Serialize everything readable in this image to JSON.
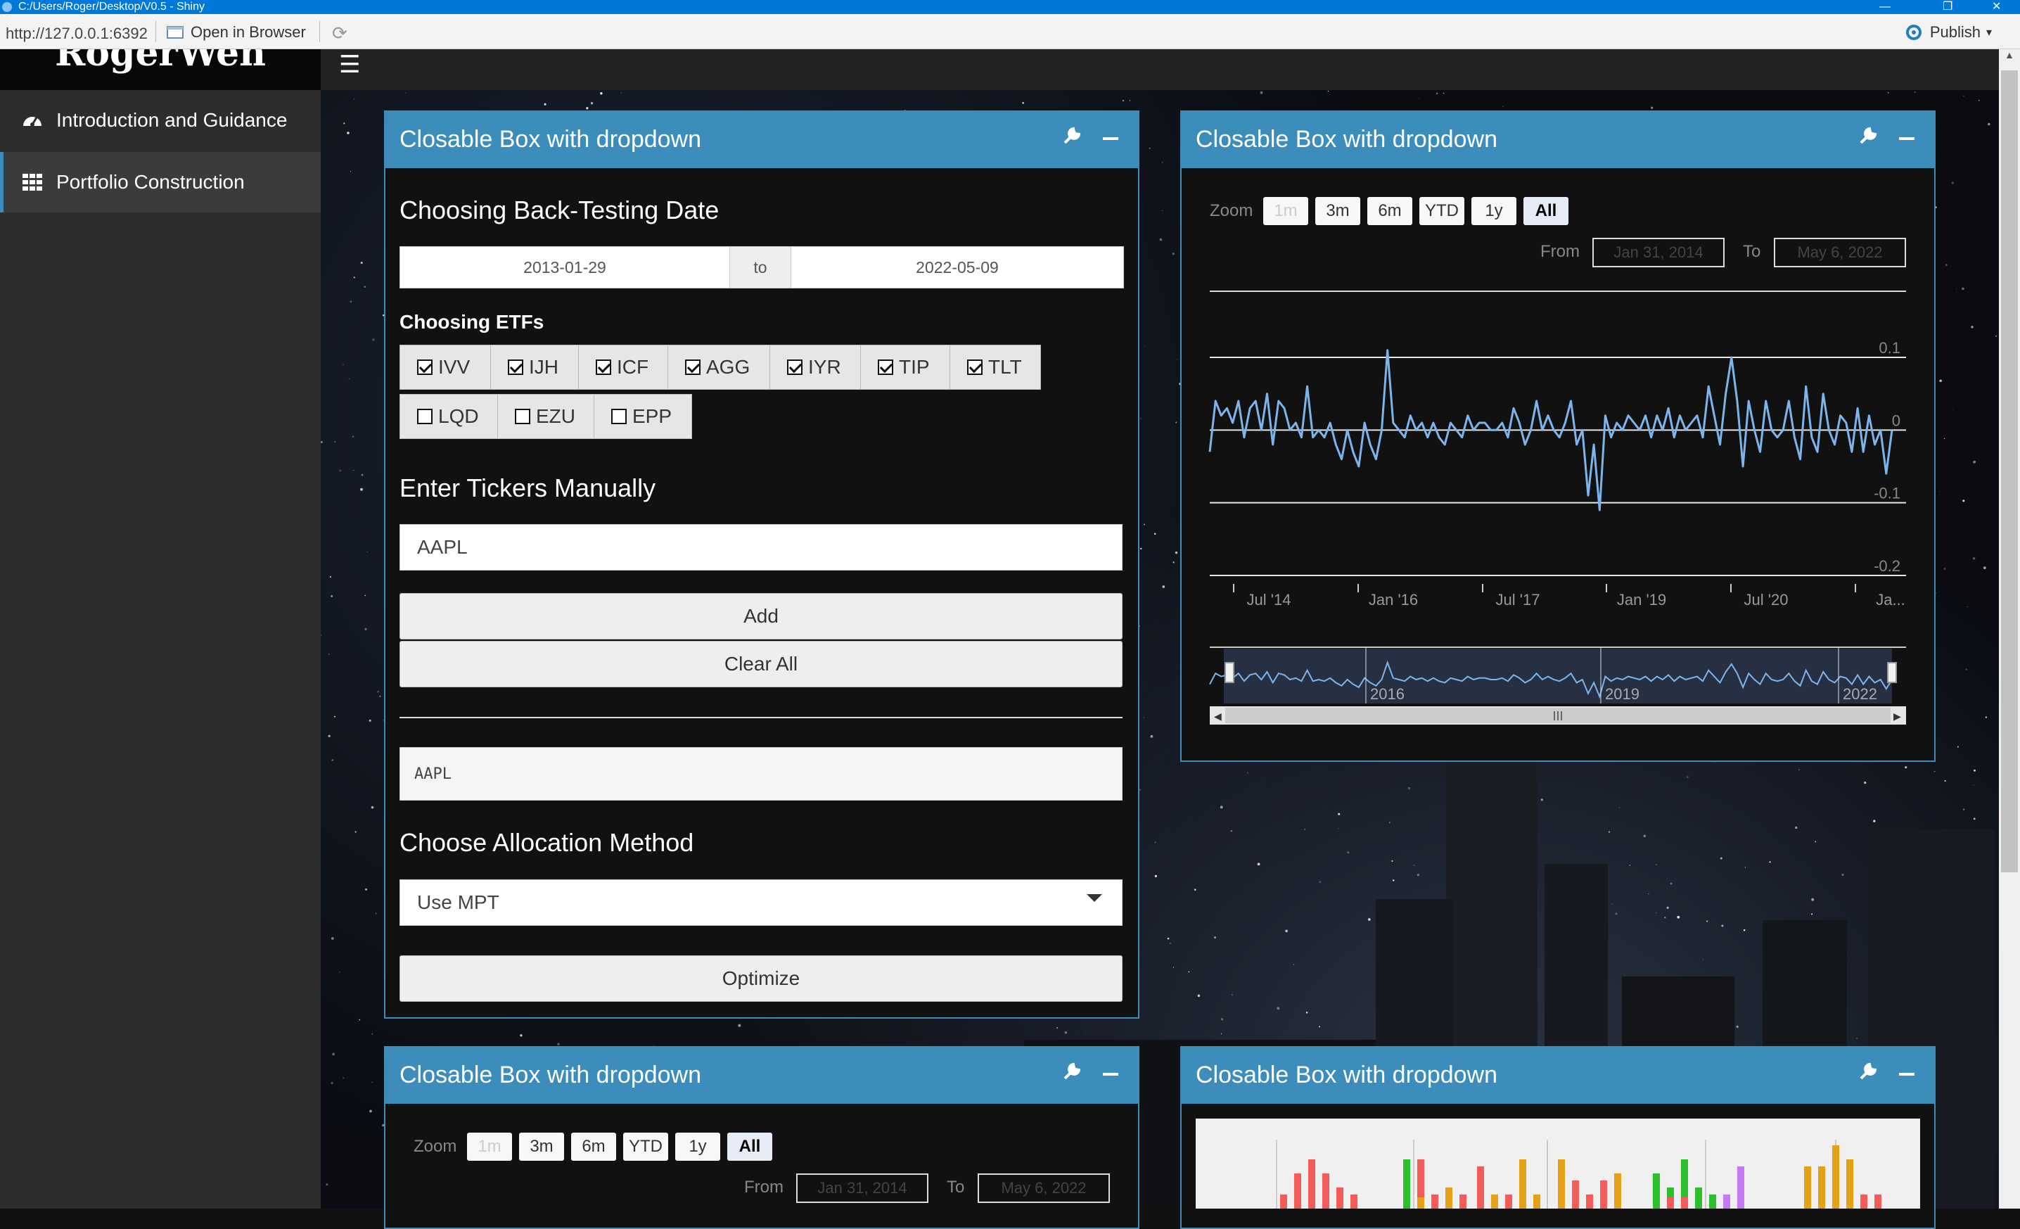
{
  "window": {
    "title": "C:/Users/Roger/Desktop/V0.5 - Shiny",
    "url": "http://127.0.0.1:6392",
    "open_in_browser": "Open in Browser",
    "publish": "Publish"
  },
  "header": {
    "logo": "RogerWen"
  },
  "sidebar": {
    "items": [
      {
        "label": "Introduction and Guidance"
      },
      {
        "label": "Portfolio Construction"
      }
    ]
  },
  "box_title": "Closable Box with dropdown",
  "form": {
    "date_heading": "Choosing Back-Testing Date",
    "date_start": "2013-01-29",
    "date_sep": "to",
    "date_end": "2022-05-09",
    "etf_heading": "Choosing ETFs",
    "etfs": [
      {
        "label": "IVV",
        "checked": true
      },
      {
        "label": "IJH",
        "checked": true
      },
      {
        "label": "ICF",
        "checked": true
      },
      {
        "label": "AGG",
        "checked": true
      },
      {
        "label": "IYR",
        "checked": true
      },
      {
        "label": "TIP",
        "checked": true
      },
      {
        "label": "TLT",
        "checked": true
      },
      {
        "label": "LQD",
        "checked": false
      },
      {
        "label": "EZU",
        "checked": false
      },
      {
        "label": "EPP",
        "checked": false
      }
    ],
    "ticker_heading": "Enter Tickers Manually",
    "ticker_value": "AAPL",
    "add_label": "Add",
    "clear_label": "Clear All",
    "ticker_output": "AAPL",
    "alloc_heading": "Choose Allocation Method",
    "alloc_value": "Use MPT",
    "optimize_label": "Optimize"
  },
  "range_selector": {
    "zoom_label": "Zoom",
    "buttons": [
      "1m",
      "3m",
      "6m",
      "YTD",
      "1y",
      "All"
    ],
    "selected": "All",
    "from_label": "From",
    "from_value": "Jan 31, 2014",
    "to_label": "To",
    "to_value": "May 6, 2022"
  },
  "chart_data": {
    "type": "line",
    "title": "",
    "xlabel": "",
    "ylabel": "",
    "ylim": [
      -0.2,
      0.1
    ],
    "y_ticks": [
      "0.1",
      "0",
      "-0.1",
      "-0.2"
    ],
    "x_ticks": [
      "Jul '14",
      "Jan '16",
      "Jul '17",
      "Jan '19",
      "Jul '20",
      "Ja..."
    ],
    "navigator_ticks": [
      "2016",
      "2019",
      "2022"
    ],
    "series": [
      {
        "color": "#7cb5ec",
        "values": [
          -0.03,
          0.04,
          0.02,
          0.03,
          0.01,
          0.04,
          -0.01,
          0.03,
          0.04,
          0.0,
          0.05,
          -0.02,
          0.04,
          0.03,
          0.0,
          0.01,
          -0.01,
          0.06,
          -0.01,
          0.0,
          -0.01,
          0.01,
          -0.02,
          -0.04,
          0.0,
          -0.03,
          -0.05,
          0.01,
          -0.02,
          -0.04,
          0.0,
          0.11,
          0.01,
          0.0,
          -0.01,
          0.02,
          0.0,
          0.01,
          -0.01,
          0.01,
          -0.01,
          -0.02,
          0.01,
          0.0,
          -0.01,
          0.02,
          0.0,
          0.01,
          0.01,
          0.0,
          0.0,
          0.01,
          -0.01,
          0.03,
          0.01,
          -0.02,
          0.0,
          0.04,
          0.0,
          0.02,
          0.0,
          -0.01,
          0.01,
          0.04,
          -0.02,
          0.0,
          -0.09,
          -0.02,
          -0.11,
          0.02,
          -0.01,
          0.01,
          0.0,
          0.02,
          0.01,
          0.0,
          0.02,
          -0.01,
          0.02,
          0.0,
          0.03,
          -0.01,
          0.02,
          0.0,
          0.01,
          0.02,
          -0.01,
          0.06,
          0.02,
          -0.02,
          0.05,
          0.1,
          0.04,
          -0.05,
          0.04,
          0.0,
          -0.03,
          0.04,
          0.0,
          -0.01,
          0.0,
          0.04,
          -0.01,
          -0.04,
          0.06,
          -0.01,
          -0.03,
          0.05,
          0.0,
          -0.02,
          0.02,
          0.01,
          -0.03,
          0.03,
          -0.03,
          0.02,
          -0.02,
          0.0,
          -0.06,
          0.0
        ]
      }
    ]
  },
  "bottom_chart": {
    "type": "bar",
    "colors": [
      "#f45b5b",
      "#e4a016",
      "#2bbf2b",
      "#c57af5",
      "#cccccc"
    ]
  },
  "colors": {
    "accent": "#3c8dbc",
    "line": "#7cb5ec"
  }
}
